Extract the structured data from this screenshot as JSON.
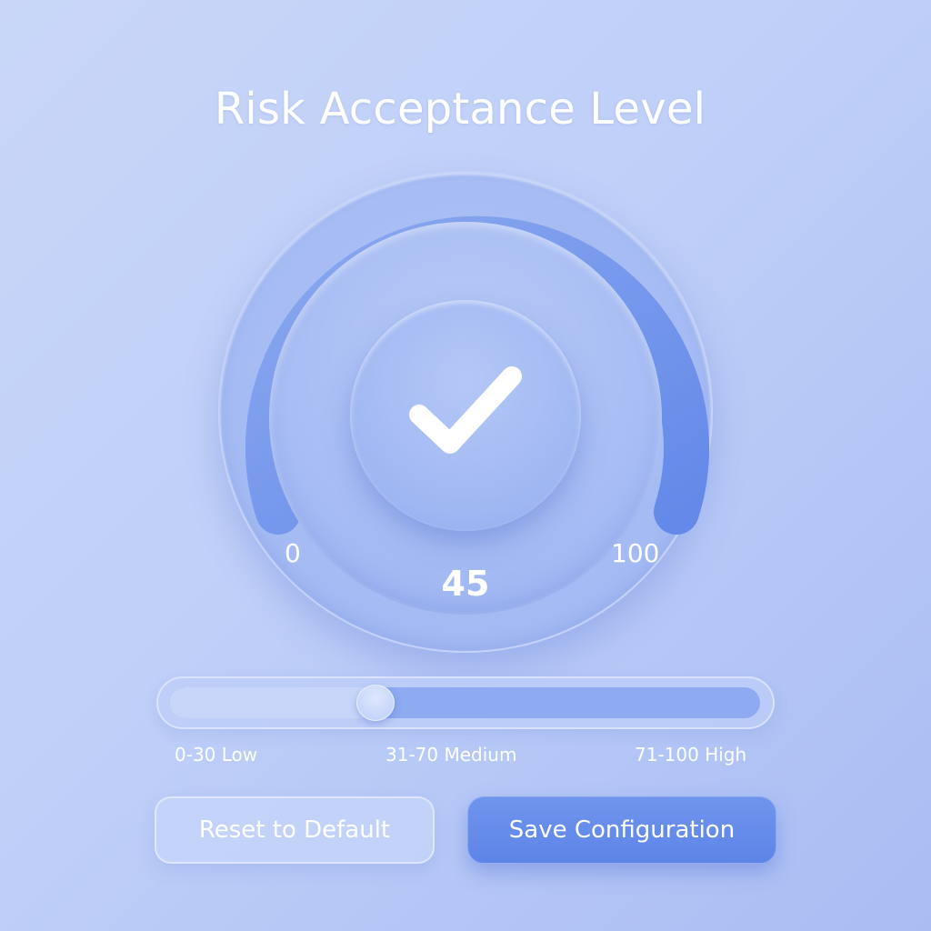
{
  "header": {
    "title": "Risk Acceptance Level"
  },
  "dial": {
    "min_label": "0",
    "max_label": "100",
    "value_label": "45",
    "value": 45,
    "min": 0,
    "max": 100,
    "center_icon": "checkmark-icon"
  },
  "slider": {
    "value": 0.35,
    "ranges": [
      {
        "label": "0-30 Low"
      },
      {
        "label": "31-70 Medium"
      },
      {
        "label": "71-100 High"
      }
    ]
  },
  "actions": {
    "reset_label": "Reset to Default",
    "save_label": "Save Configuration"
  },
  "colors": {
    "background": "#c3d2f7",
    "accent": "#5d85e8",
    "arc": "#7396ec",
    "text": "#ffffff"
  }
}
